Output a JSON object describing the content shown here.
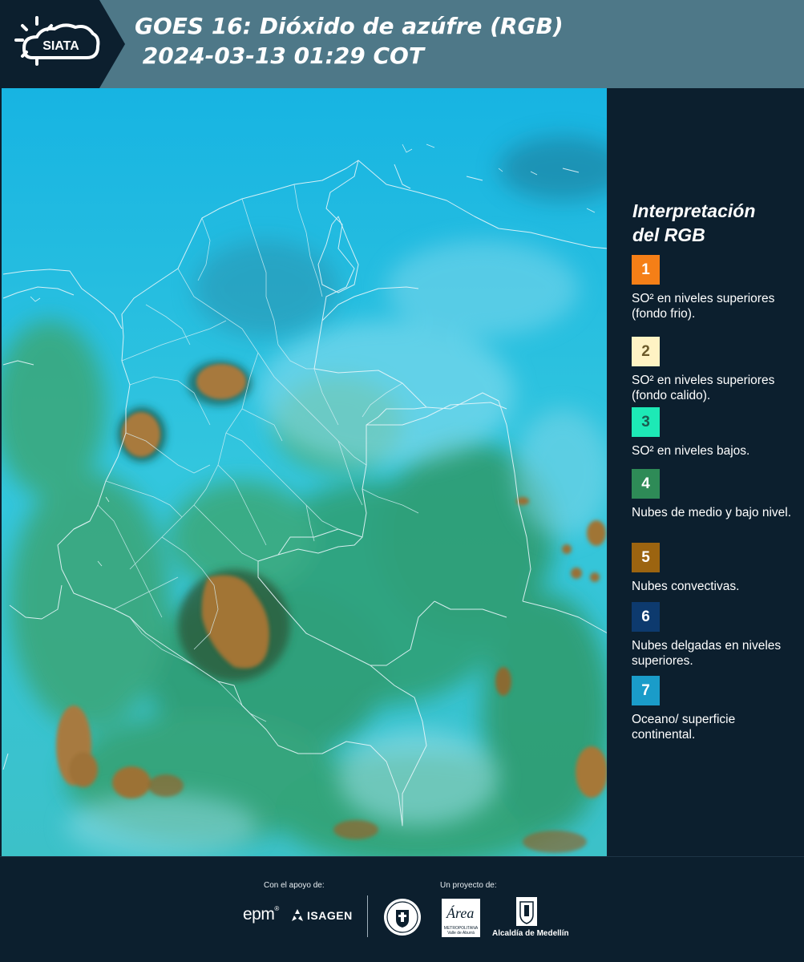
{
  "header": {
    "logo_text": "SIATA",
    "title_line1": "GOES 16: Dióxido de azúfre (RGB)",
    "title_line2": " 2024-03-13 01:29 COT"
  },
  "legend": {
    "title_line1": "Interpretación",
    "title_line2": "del RGB",
    "items": [
      {
        "number": "1",
        "label": "SO² en niveles superiores (fondo frio).",
        "color": "#f57f17",
        "text_color": "#ffffff"
      },
      {
        "number": "2",
        "label": "SO² en niveles superiores (fondo calido).",
        "color": "#fff3c4",
        "text_color": "#6b5a2a"
      },
      {
        "number": "3",
        "label": "SO² en niveles bajos.",
        "color": "#1de9b6",
        "text_color": "#1a5c50"
      },
      {
        "number": "4",
        "label": "Nubes de medio y bajo nivel.",
        "color": "#2e8b57",
        "text_color": "#ffffff"
      },
      {
        "number": "5",
        "label": "Nubes convectivas.",
        "color": "#9c6410",
        "text_color": "#ffffff"
      },
      {
        "number": "6",
        "label": "Nubes delgadas en niveles superiores.",
        "color": "#0d3a6e",
        "text_color": "#ffffff"
      },
      {
        "number": "7",
        "label": "Oceano/ superficie continental.",
        "color": "#1a9cc9",
        "text_color": "#ffffff"
      }
    ]
  },
  "footer": {
    "support_label": "Con el apoyo de:",
    "project_label": "Un proyecto de:",
    "sponsor_epm": "epm",
    "sponsor_isagen": "ISAGEN",
    "area_logo_text": "Área",
    "area_subtitle": "METROPOLITANA Valle de Aburrá",
    "alcaldia": "Alcaldía de Medellín"
  }
}
